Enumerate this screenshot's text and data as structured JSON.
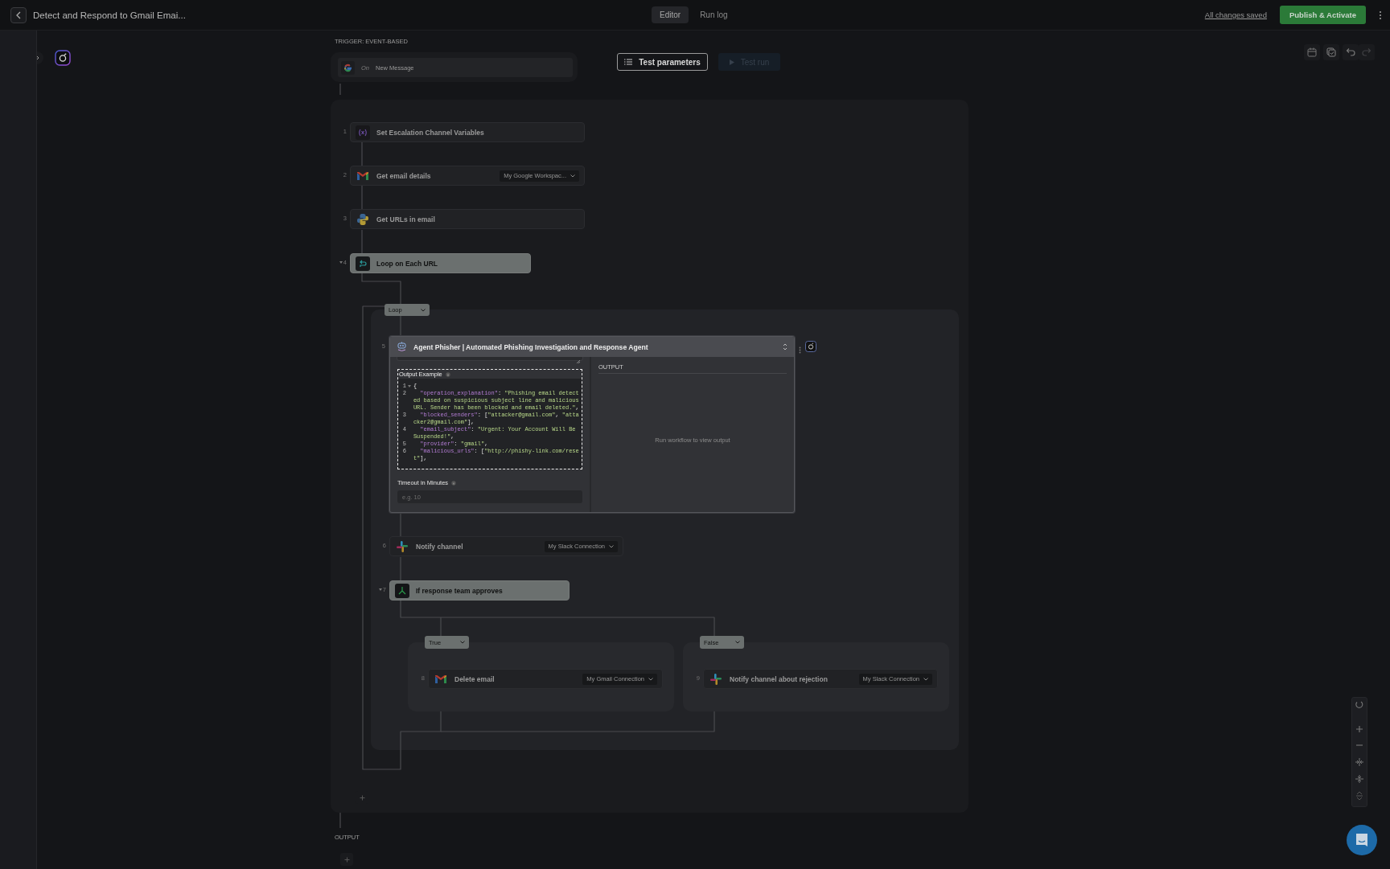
{
  "header": {
    "title": "Detect and Respond to Gmail Emai...",
    "tabs": [
      {
        "label": "Editor",
        "selected": true
      },
      {
        "label": "Run log",
        "selected": false
      }
    ],
    "save_status": "All changes saved",
    "publish_button": "Publish & Activate"
  },
  "trigger": {
    "label": "TRIGGER: EVENT-BASED",
    "prefix": "On",
    "event": "New Message"
  },
  "test_parameters_button": "Test parameters",
  "test_run_button": {
    "label": "Test run",
    "disabled": true
  },
  "steps": [
    {
      "number": "1",
      "title": "Set Escalation Channel Variables",
      "kind": "variables",
      "highlighted": false
    },
    {
      "number": "2",
      "title": "Get email details",
      "kind": "gmail",
      "connection": "My Google Workspac...",
      "highlighted": false
    },
    {
      "number": "3",
      "title": "Get URLs in email",
      "kind": "python",
      "highlighted": false
    },
    {
      "number": "4",
      "title": "Loop on Each URL",
      "kind": "loop",
      "highlighted": true,
      "expanded": true
    }
  ],
  "loop": {
    "tag": "Loop",
    "steps": [
      {
        "kind": "agent",
        "number": "5",
        "title": "Agent Phisher | Automated Phishing Investigation and Response Agent",
        "output_example_label": "Output Example",
        "code_lines": [
          {
            "number": "1",
            "foldable": true,
            "tokens": [
              {
                "kind": "punct",
                "text": "{"
              }
            ]
          },
          {
            "number": "2",
            "foldable": false,
            "tokens": [
              {
                "kind": "key",
                "text": "  \"operation_explanation\""
              },
              {
                "kind": "punct",
                "text": ": "
              },
              {
                "kind": "string",
                "text": "\"Phishing email detected based on suspicious subject line and malicious URL. Sender has been blocked and email deleted.\""
              },
              {
                "kind": "punct",
                "text": ","
              }
            ]
          },
          {
            "number": "3",
            "foldable": false,
            "tokens": [
              {
                "kind": "key",
                "text": "  \"blocked_senders\""
              },
              {
                "kind": "punct",
                "text": ": ["
              },
              {
                "kind": "string",
                "text": "\"attacker@gmail.com\""
              },
              {
                "kind": "punct",
                "text": ", "
              },
              {
                "kind": "string",
                "text": "\"attacker2@gmail.com\""
              },
              {
                "kind": "punct",
                "text": "],"
              }
            ]
          },
          {
            "number": "4",
            "foldable": false,
            "tokens": [
              {
                "kind": "key",
                "text": "  \"email_subject\""
              },
              {
                "kind": "punct",
                "text": ": "
              },
              {
                "kind": "string",
                "text": "\"Urgent: Your Account Will Be Suspended!\""
              },
              {
                "kind": "punct",
                "text": ","
              }
            ]
          },
          {
            "number": "5",
            "foldable": false,
            "tokens": [
              {
                "kind": "key",
                "text": "  \"provider\""
              },
              {
                "kind": "punct",
                "text": ": "
              },
              {
                "kind": "string",
                "text": "\"gmail\""
              },
              {
                "kind": "punct",
                "text": ","
              }
            ]
          },
          {
            "number": "6",
            "foldable": false,
            "tokens": [
              {
                "kind": "key",
                "text": "  \"malicious_urls\""
              },
              {
                "kind": "punct",
                "text": ": ["
              },
              {
                "kind": "string",
                "text": "\"http://phishy-link.com/reset\""
              },
              {
                "kind": "punct",
                "text": "],"
              }
            ]
          }
        ],
        "timeout_label": "Timeout in Minutes",
        "timeout_placeholder": "e.g. 10",
        "output_heading": "OUTPUT",
        "output_empty": "Run workflow to view output"
      },
      {
        "kind": "slack",
        "number": "6",
        "title": "Notify channel",
        "connection": "My Slack Connection",
        "highlighted": false
      },
      {
        "kind": "branch",
        "number": "7",
        "title": "If response team approves",
        "highlighted": true,
        "expanded": true,
        "branches": [
          {
            "label": "True",
            "steps": [
              {
                "number": "8",
                "title": "Delete email",
                "kind": "gmail",
                "connection": "My Gmail Connection",
                "highlighted": false
              }
            ]
          },
          {
            "label": "False",
            "steps": [
              {
                "number": "9",
                "title": "Notify channel about rejection",
                "kind": "slack",
                "connection": "My Slack Connection",
                "highlighted": false
              }
            ]
          }
        ]
      }
    ]
  },
  "output_label": "OUTPUT"
}
